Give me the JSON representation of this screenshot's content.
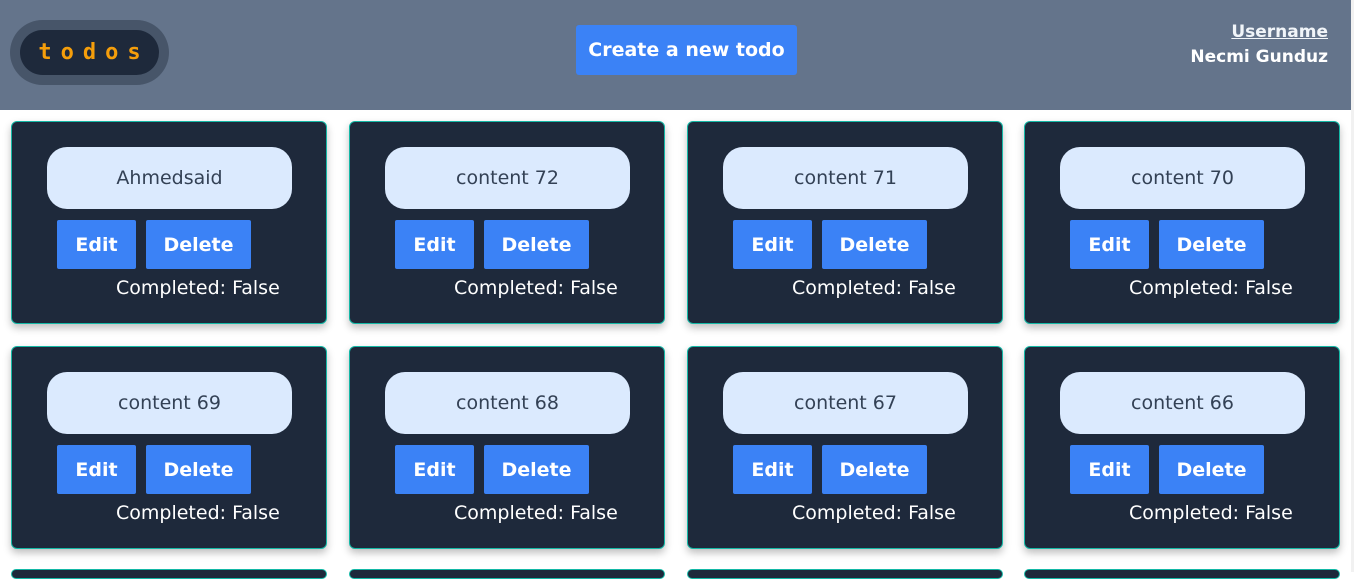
{
  "app": {
    "logo_text": "todos",
    "create_button_label": "Create a new todo"
  },
  "user": {
    "label": "Username",
    "name": "Necmi Gunduz"
  },
  "todos": [
    {
      "content": "Ahmedsaid",
      "edit_label": "Edit",
      "delete_label": "Delete",
      "completed_label": "Completed: False"
    },
    {
      "content": "content 72",
      "edit_label": "Edit",
      "delete_label": "Delete",
      "completed_label": "Completed: False"
    },
    {
      "content": "content 71",
      "edit_label": "Edit",
      "delete_label": "Delete",
      "completed_label": "Completed: False"
    },
    {
      "content": "content 70",
      "edit_label": "Edit",
      "delete_label": "Delete",
      "completed_label": "Completed: False"
    },
    {
      "content": "content 69",
      "edit_label": "Edit",
      "delete_label": "Delete",
      "completed_label": "Completed: False"
    },
    {
      "content": "content 68",
      "edit_label": "Edit",
      "delete_label": "Delete",
      "completed_label": "Completed: False"
    },
    {
      "content": "content 67",
      "edit_label": "Edit",
      "delete_label": "Delete",
      "completed_label": "Completed: False"
    },
    {
      "content": "content 66",
      "edit_label": "Edit",
      "delete_label": "Delete",
      "completed_label": "Completed: False"
    }
  ],
  "colors": {
    "header_bg": "#64748b",
    "card_bg": "#1e293b",
    "accent": "#3b82f6",
    "logo_text": "#f59e0b",
    "content_pill": "#dbeafe"
  }
}
